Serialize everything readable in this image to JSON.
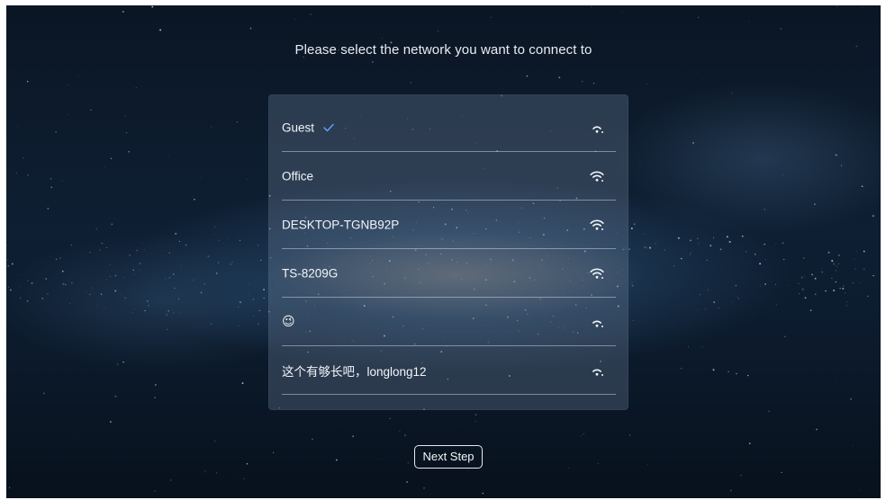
{
  "header": {
    "title": "Please select the network you want to connect to"
  },
  "networks": [
    {
      "name": "Guest",
      "connected": true,
      "signal_icon": "wifi-weak-icon"
    },
    {
      "name": "Office",
      "connected": false,
      "signal_icon": "wifi-strong-icon"
    },
    {
      "name": "DESKTOP-TGNB92P",
      "connected": false,
      "signal_icon": "wifi-strong-icon"
    },
    {
      "name": "TS-8209G",
      "connected": false,
      "signal_icon": "wifi-strong-icon"
    },
    {
      "name": "😉",
      "connected": false,
      "signal_icon": "wifi-medium-icon"
    },
    {
      "name": "这个有够长吧，longlong12",
      "connected": false,
      "signal_icon": "wifi-medium-icon"
    }
  ],
  "footer": {
    "next_label": "Next Step"
  },
  "colors": {
    "accent_check": "#5aa2ff",
    "text": "#f2f5f9",
    "background_dark": "#0b1624"
  }
}
